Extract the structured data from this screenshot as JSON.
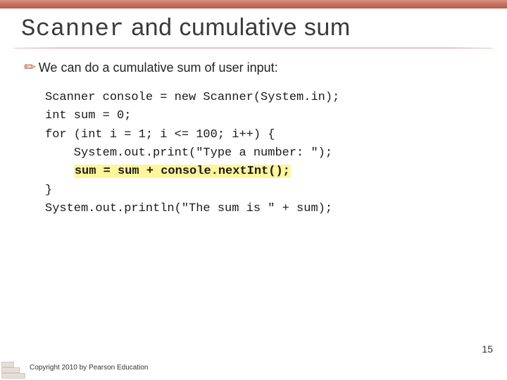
{
  "title": {
    "mono": "Scanner",
    "rest": " and cumulative sum"
  },
  "bullet": "We can do a cumulative sum of user input:",
  "code": {
    "l1": "Scanner console = new Scanner(System.in);",
    "l2": "int sum = 0;",
    "l3": "for (int i = 1; i <= 100; i++) {",
    "l4": "    System.out.print(\"Type a number: \");",
    "l5pre": "    ",
    "l5hl": "sum = sum + console.nextInt();",
    "l6": "}",
    "l7": "System.out.println(\"The sum is \" + sum);"
  },
  "pageNumber": "15",
  "copyright": "Copyright 2010 by Pearson Education"
}
